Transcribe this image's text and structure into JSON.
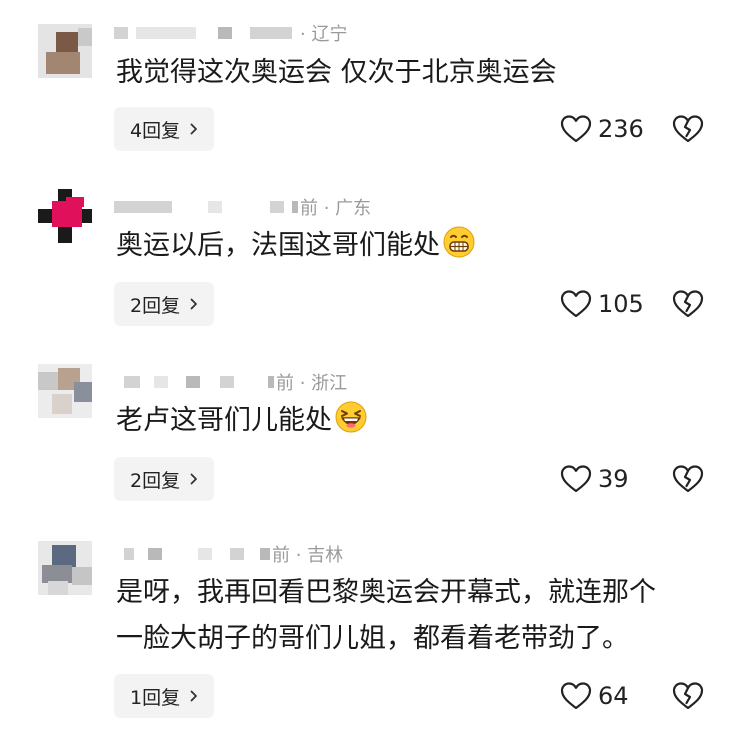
{
  "comments": [
    {
      "meta_text": "· 辽宁",
      "body_lines": [
        "我觉得这次奥运会 仅次于北京奥运会"
      ],
      "emoji": null,
      "reply_label": "4回复",
      "likes": "236"
    },
    {
      "meta_text": "前 · 广东",
      "body_lines": [
        "奥运以后，法国这哥们能处"
      ],
      "emoji": "grin-emoji",
      "reply_label": "2回复",
      "likes": "105"
    },
    {
      "meta_text": "前 · 浙江",
      "body_lines": [
        "老卢这哥们儿能处"
      ],
      "emoji": "laugh-emoji",
      "reply_label": "2回复",
      "likes": "39"
    },
    {
      "meta_text": "前 · 吉林",
      "body_lines": [
        "是呀，我再回看巴黎奥运会开幕式，就连那个",
        "一脸大胡子的哥们儿姐，都看着老带劲了。"
      ],
      "emoji": null,
      "reply_label": "1回复",
      "likes": "64"
    }
  ],
  "icons": {
    "like": "heart-outline-icon",
    "dislike": "broken-heart-icon",
    "reply_arrow": "chevron-right-icon"
  },
  "colors": {
    "meta_text": "#9a9a9a",
    "reply_bg": "#f3f3f3",
    "avatar_accent": "#e0105a"
  }
}
